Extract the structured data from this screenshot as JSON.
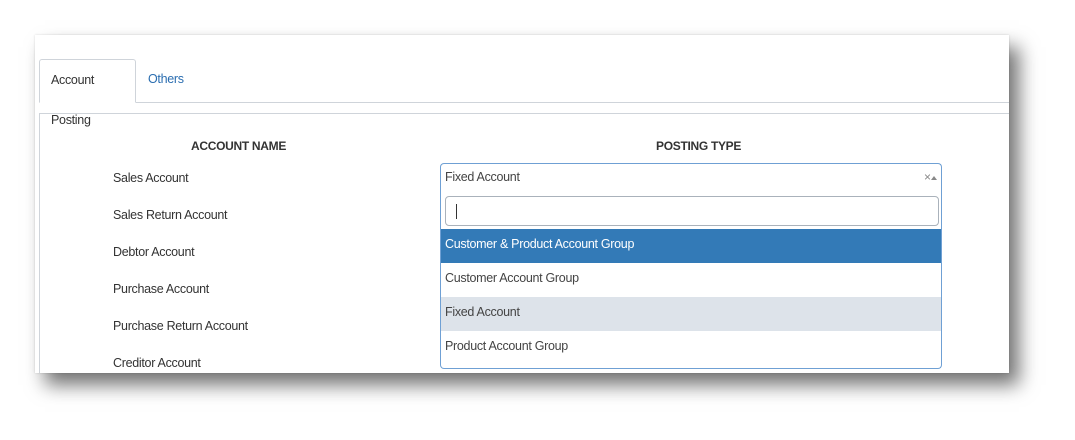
{
  "tabs": [
    {
      "label": "Account Posting",
      "active": true
    },
    {
      "label": "Others",
      "active": false
    }
  ],
  "table": {
    "headers": {
      "account_name": "ACCOUNT NAME",
      "posting_type": "POSTING TYPE"
    },
    "accounts": [
      "Sales Account",
      "Sales Return Account",
      "Debtor Account",
      "Purchase Account",
      "Purchase Return Account",
      "Creditor Account"
    ]
  },
  "posting_select": {
    "selected_value": "Fixed Account",
    "clear_symbol": "×",
    "search_value": "",
    "options": [
      {
        "label": "Customer & Product Account Group",
        "state": "highlighted"
      },
      {
        "label": "Customer Account Group",
        "state": "normal"
      },
      {
        "label": "Fixed Account",
        "state": "selected"
      },
      {
        "label": "Product Account Group",
        "state": "normal"
      }
    ]
  },
  "colors": {
    "tab_link": "#2a6db0",
    "highlight": "#337ab7",
    "selected_option": "#dde3ea",
    "focus_border": "#6fa0d4"
  },
  "icons": {
    "clear": "close-icon",
    "toggle": "chevron-up-icon"
  }
}
